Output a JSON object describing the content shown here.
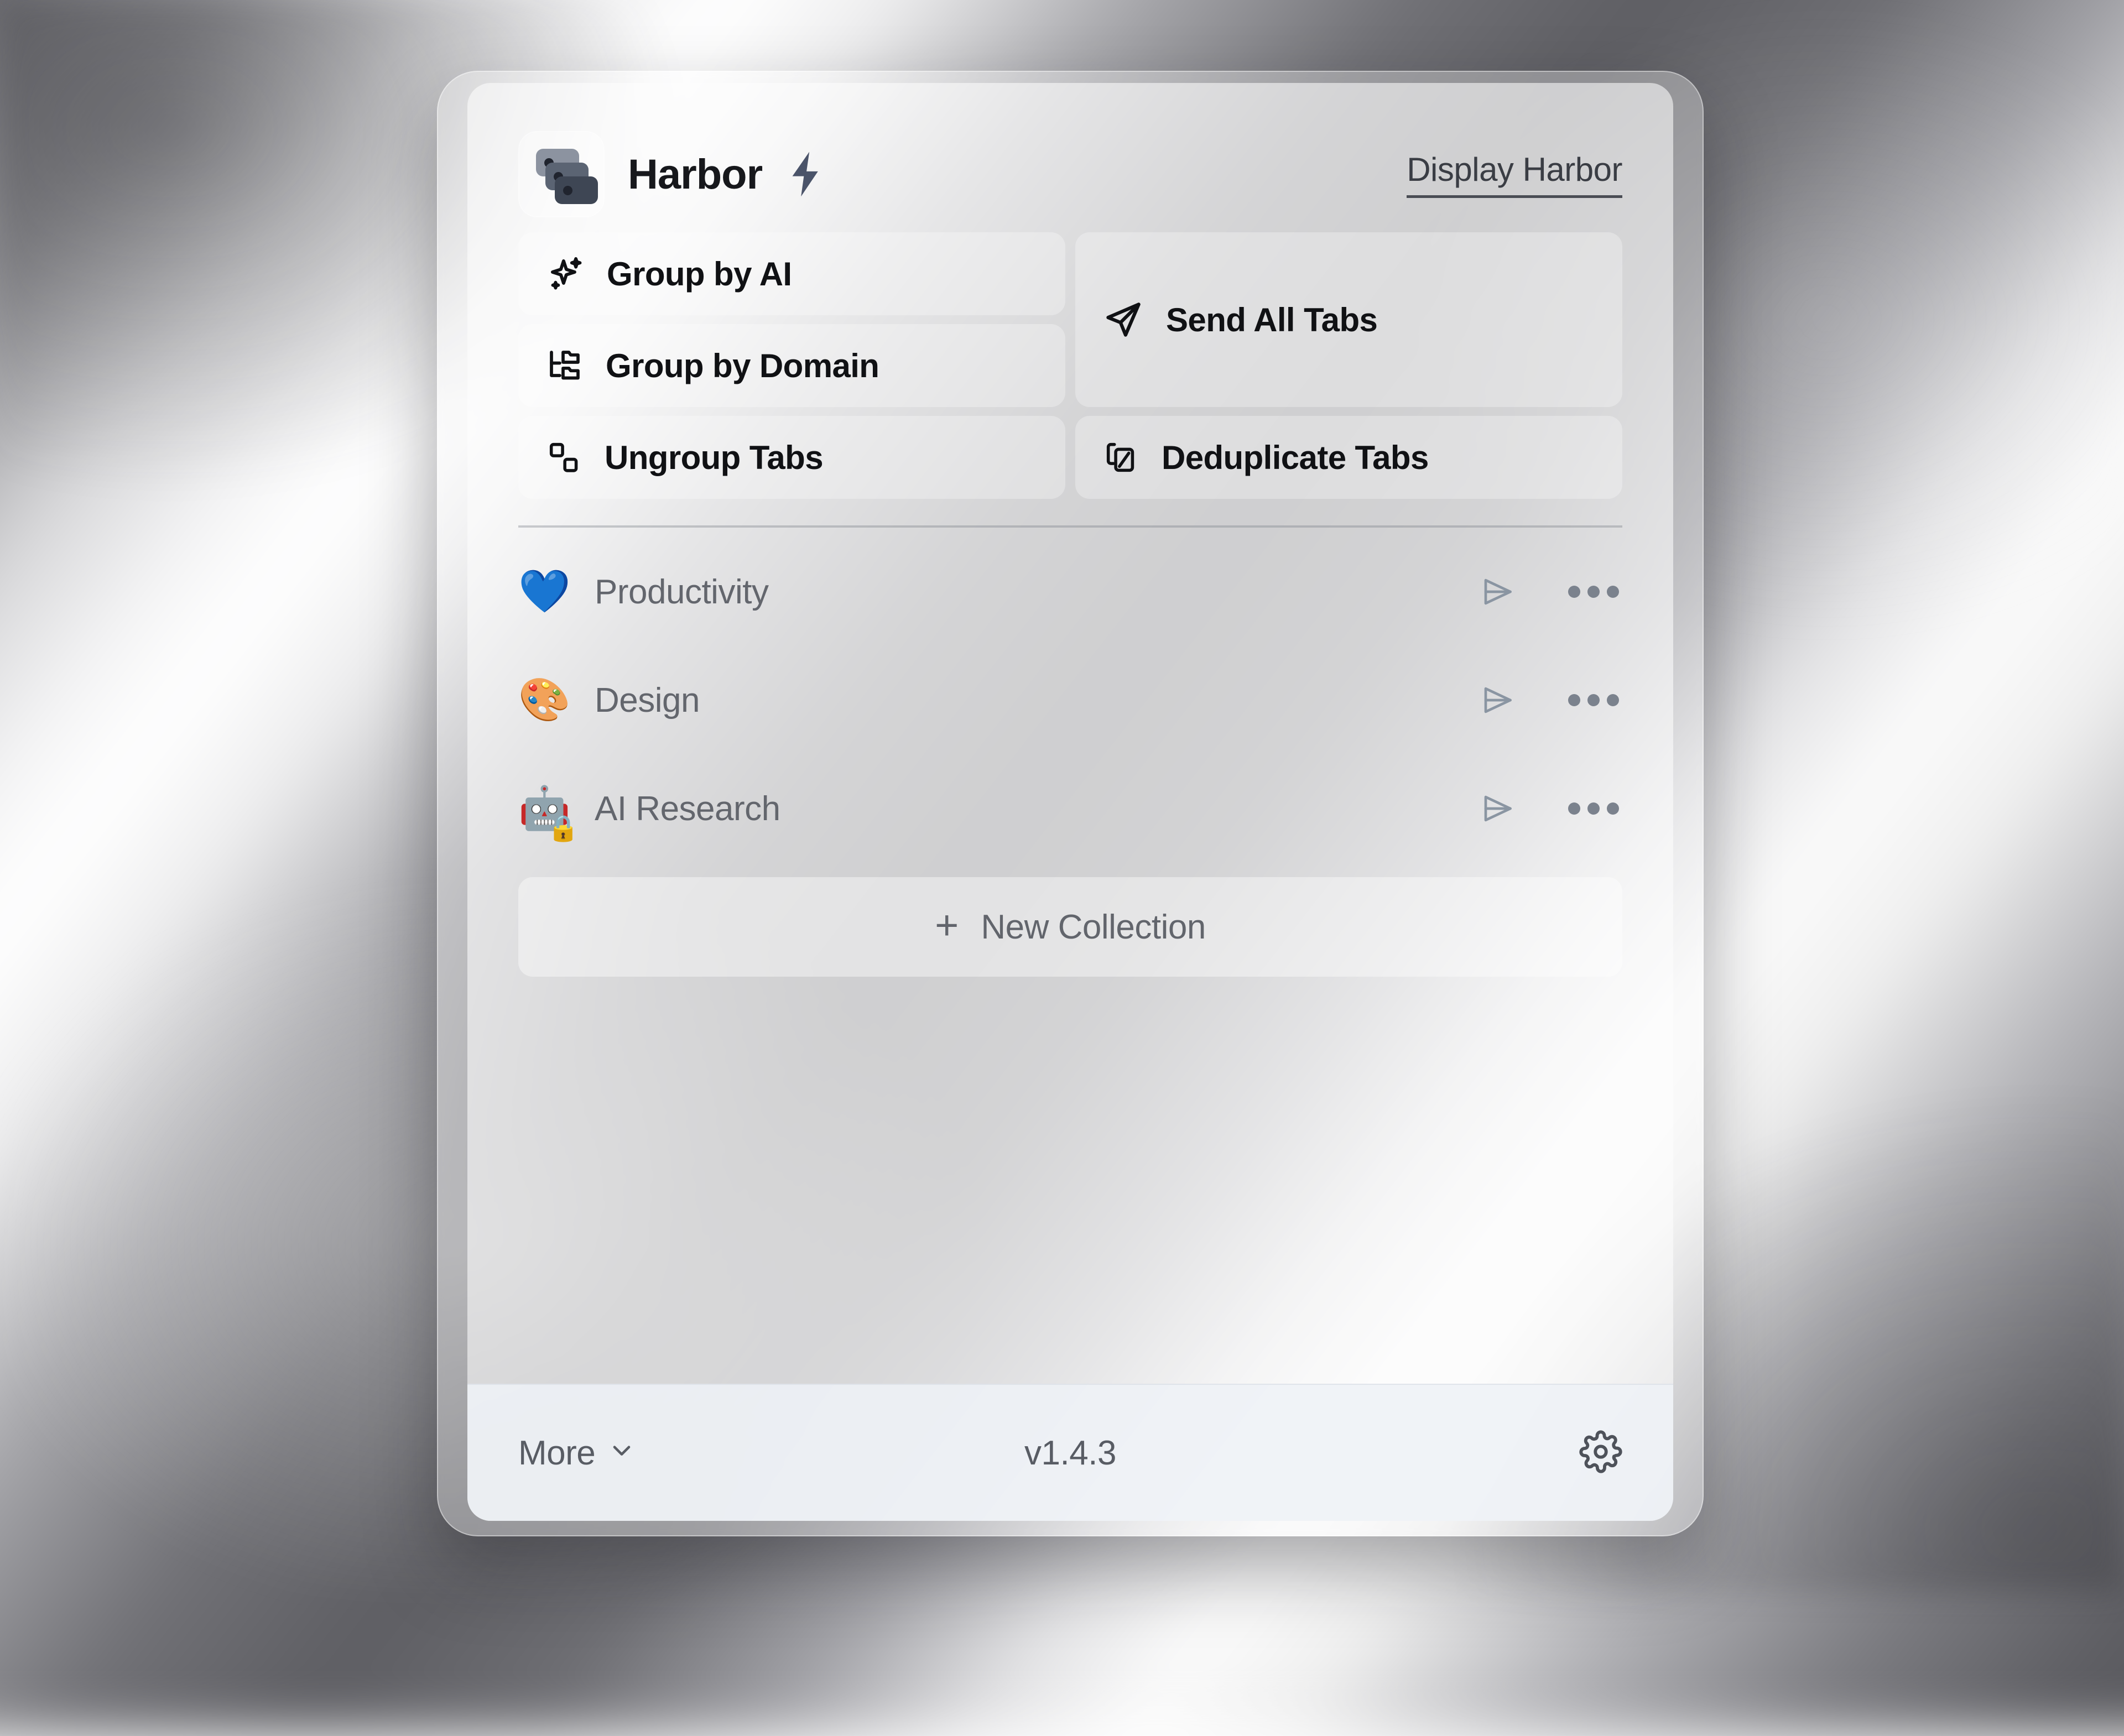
{
  "header": {
    "app_name": "Harbor",
    "bolt_icon": "lightning-bolt-icon",
    "logo_icon": "stacked-tabs-logo-icon",
    "display_link": "Display Harbor"
  },
  "actions": [
    {
      "id": "group-by-ai",
      "label": "Group by AI",
      "icon": "sparkles-icon"
    },
    {
      "id": "group-by-domain",
      "label": "Group by Domain",
      "icon": "folder-tree-icon"
    },
    {
      "id": "ungroup-tabs",
      "label": "Ungroup Tabs",
      "icon": "ungroup-squares-icon"
    },
    {
      "id": "send-all-tabs",
      "label": "Send All Tabs",
      "icon": "send-plane-icon"
    },
    {
      "id": "deduplicate-tabs",
      "label": "Deduplicate Tabs",
      "icon": "copy-slash-icon"
    }
  ],
  "collections": [
    {
      "name": "Productivity",
      "emoji": "💙",
      "emoji_name": "blue-heart-emoji",
      "locked": false,
      "send_icon": "send-plane-icon",
      "more_icon": "ellipsis-icon"
    },
    {
      "name": "Design",
      "emoji": "🎨",
      "emoji_name": "artist-palette-emoji",
      "locked": false,
      "send_icon": "send-plane-icon",
      "more_icon": "ellipsis-icon"
    },
    {
      "name": "AI Research",
      "emoji": "🤖",
      "emoji_name": "robot-emoji",
      "locked": true,
      "lock_emoji": "🔒",
      "send_icon": "send-plane-icon",
      "more_icon": "ellipsis-icon"
    }
  ],
  "new_collection": {
    "label": "New Collection",
    "plus": "+",
    "icon": "plus-icon"
  },
  "footer": {
    "more_label": "More",
    "more_chevron_icon": "chevron-down-icon",
    "version": "v1.4.3",
    "settings_icon": "gear-icon"
  },
  "colors": {
    "title_text": "#17181c",
    "action_text": "#101114",
    "collection_text": "#63666d",
    "muted_text": "#585c64",
    "link_text": "#3a3d44",
    "bolt": "#4a5369",
    "send_arrow": "#8a95a2",
    "logo_light": "#8c93a0",
    "logo_mid": "#5b6473",
    "logo_dark": "#3e4654",
    "footer_bg": "#eef1f6"
  }
}
